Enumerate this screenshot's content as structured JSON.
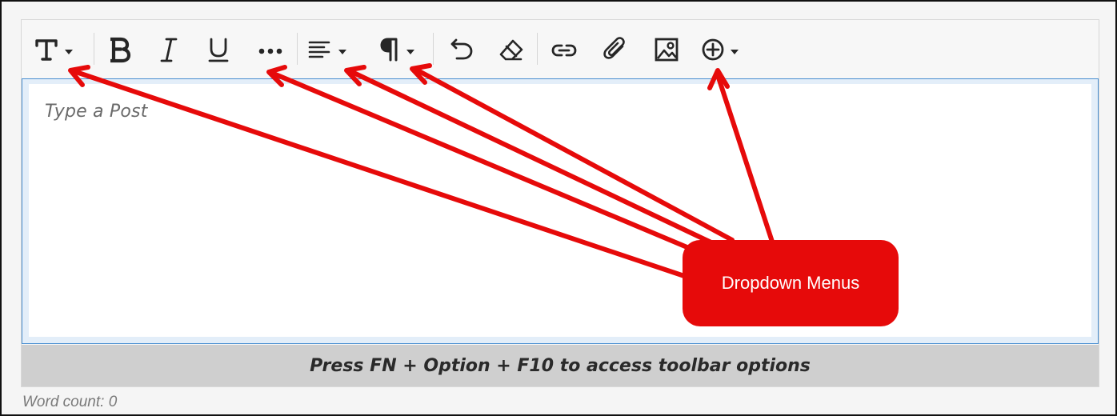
{
  "toolbar": {
    "buttons": [
      {
        "id": "text-style",
        "icon": "text-format-icon",
        "has_dropdown": true
      },
      {
        "id": "bold",
        "icon": "bold-icon"
      },
      {
        "id": "italic",
        "icon": "italic-icon"
      },
      {
        "id": "underline",
        "icon": "underline-icon"
      },
      {
        "id": "more",
        "icon": "ellipsis-icon"
      },
      {
        "id": "align",
        "icon": "align-left-icon",
        "has_dropdown": true
      },
      {
        "id": "paragraph",
        "icon": "paragraph-icon",
        "has_dropdown": true
      },
      {
        "id": "undo",
        "icon": "undo-icon"
      },
      {
        "id": "clear-format",
        "icon": "eraser-icon"
      },
      {
        "id": "link",
        "icon": "link-icon"
      },
      {
        "id": "attach",
        "icon": "paperclip-icon"
      },
      {
        "id": "image",
        "icon": "image-icon"
      },
      {
        "id": "insert",
        "icon": "plus-circle-icon",
        "has_dropdown": true
      }
    ]
  },
  "editor": {
    "placeholder": "Type a Post"
  },
  "hint": {
    "text": "Press FN + Option + F10 to access toolbar options"
  },
  "footer": {
    "word_count": "Word count: 0"
  },
  "annotation": {
    "label": "Dropdown Menus",
    "color": "#e60a0a"
  },
  "colors": {
    "focus_border": "#4a8fd1",
    "hint_bar": "#cfcfcf"
  }
}
